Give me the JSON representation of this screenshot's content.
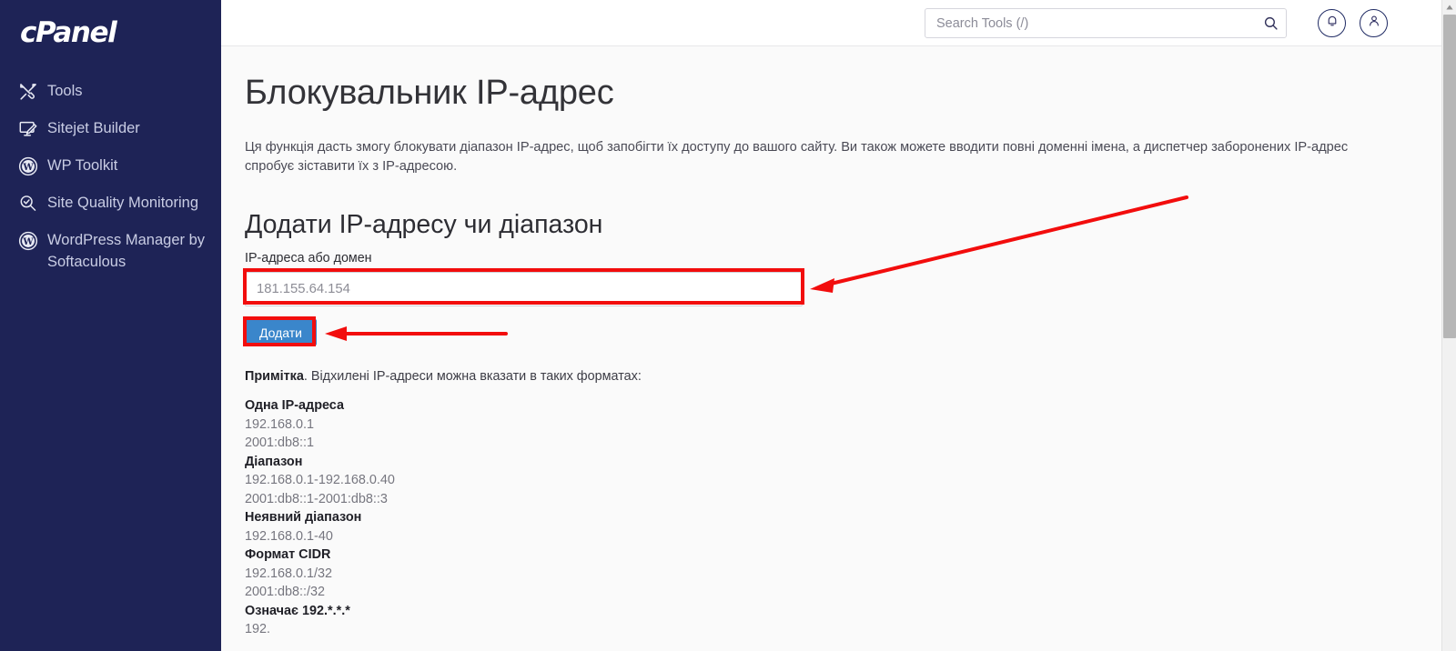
{
  "brand": {
    "name": "cPanel"
  },
  "sidebar": {
    "items": [
      {
        "label": "Tools",
        "icon": "tools-icon"
      },
      {
        "label": "Sitejet Builder",
        "icon": "sitejet-builder-icon"
      },
      {
        "label": "WP Toolkit",
        "icon": "wordpress-icon"
      },
      {
        "label": "Site Quality Monitoring",
        "icon": "site-quality-icon"
      },
      {
        "label": "WordPress Manager by Softaculous",
        "icon": "wordpress-icon"
      }
    ]
  },
  "header": {
    "search": {
      "placeholder": "Search Tools (/)",
      "value": "",
      "icon": "search-icon"
    },
    "notifications_icon": "bell-icon",
    "account_icon": "user-icon"
  },
  "main": {
    "page_title": "Блокувальник IP-адрес",
    "description": "Ця функція дасть змогу блокувати діапазон IP-адрес, щоб запобігти їх доступу до вашого сайту. Ви також можете вводити повні доменні імена, а диспетчер заборонених IP-адрес спробує зіставити їх з IP-адресою.",
    "section_title": "Додати IP-адресу чи діапазон",
    "field_label": "IP-адреса або домен",
    "ip_input": {
      "value": "181.155.64.154",
      "placeholder": "181.155.64.154"
    },
    "add_button": "Додати",
    "note_bold": "Примітка",
    "note_rest": ". Відхилені IP-адреси можна вказати в таких форматах:",
    "formats": [
      {
        "heading": "Одна IP-адреса",
        "values": [
          "192.168.0.1",
          "2001:db8::1"
        ]
      },
      {
        "heading": "Діапазон",
        "values": [
          "192.168.0.1-192.168.0.40",
          "2001:db8::1-2001:db8::3"
        ]
      },
      {
        "heading": "Неявний діапазон",
        "values": [
          "192.168.0.1-40"
        ]
      },
      {
        "heading": "Формат CIDR",
        "values": [
          "192.168.0.1/32",
          "2001:db8::/32"
        ]
      },
      {
        "heading": "Означає 192.*.*.*",
        "values": [
          "192."
        ]
      }
    ]
  },
  "annotations": {
    "arrow_to_input": "arrow-pointing-to-ip-input",
    "arrow_to_button": "arrow-pointing-to-add-button",
    "highlight_color": "#f20d0d"
  },
  "colors": {
    "sidebar_bg": "#1e2356",
    "accent_blue": "#3a86cb",
    "annotation_red": "#f20d0d",
    "page_bg": "#fafafa"
  }
}
